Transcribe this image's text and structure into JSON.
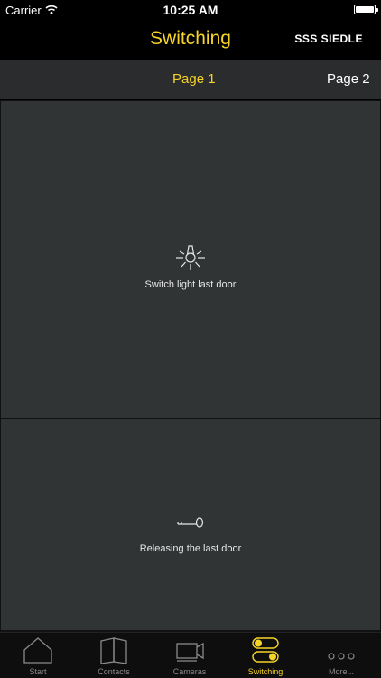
{
  "status_bar": {
    "carrier": "Carrier",
    "time": "10:25 AM"
  },
  "nav": {
    "title": "Switching",
    "brand": "SSS SIEDLE"
  },
  "page_tabs": [
    {
      "label": "Page 1",
      "active": true
    },
    {
      "label": "Page 2",
      "active": false
    }
  ],
  "tiles": [
    {
      "label": "Switch light last door",
      "icon": "lightbulb-icon"
    },
    {
      "label": "Releasing the last door",
      "icon": "door-key-icon"
    }
  ],
  "tab_bar": {
    "items": [
      {
        "label": "Start",
        "icon": "house-icon",
        "selected": false
      },
      {
        "label": "Contacts",
        "icon": "book-icon",
        "selected": false
      },
      {
        "label": "Cameras",
        "icon": "camera-icon",
        "selected": false
      },
      {
        "label": "Switching",
        "icon": "switch-icon",
        "selected": true
      },
      {
        "label": "More...",
        "icon": "more-icon",
        "selected": false
      }
    ]
  },
  "colors": {
    "accent": "#f5d327",
    "tile": "#313435",
    "bar": "#000000"
  }
}
